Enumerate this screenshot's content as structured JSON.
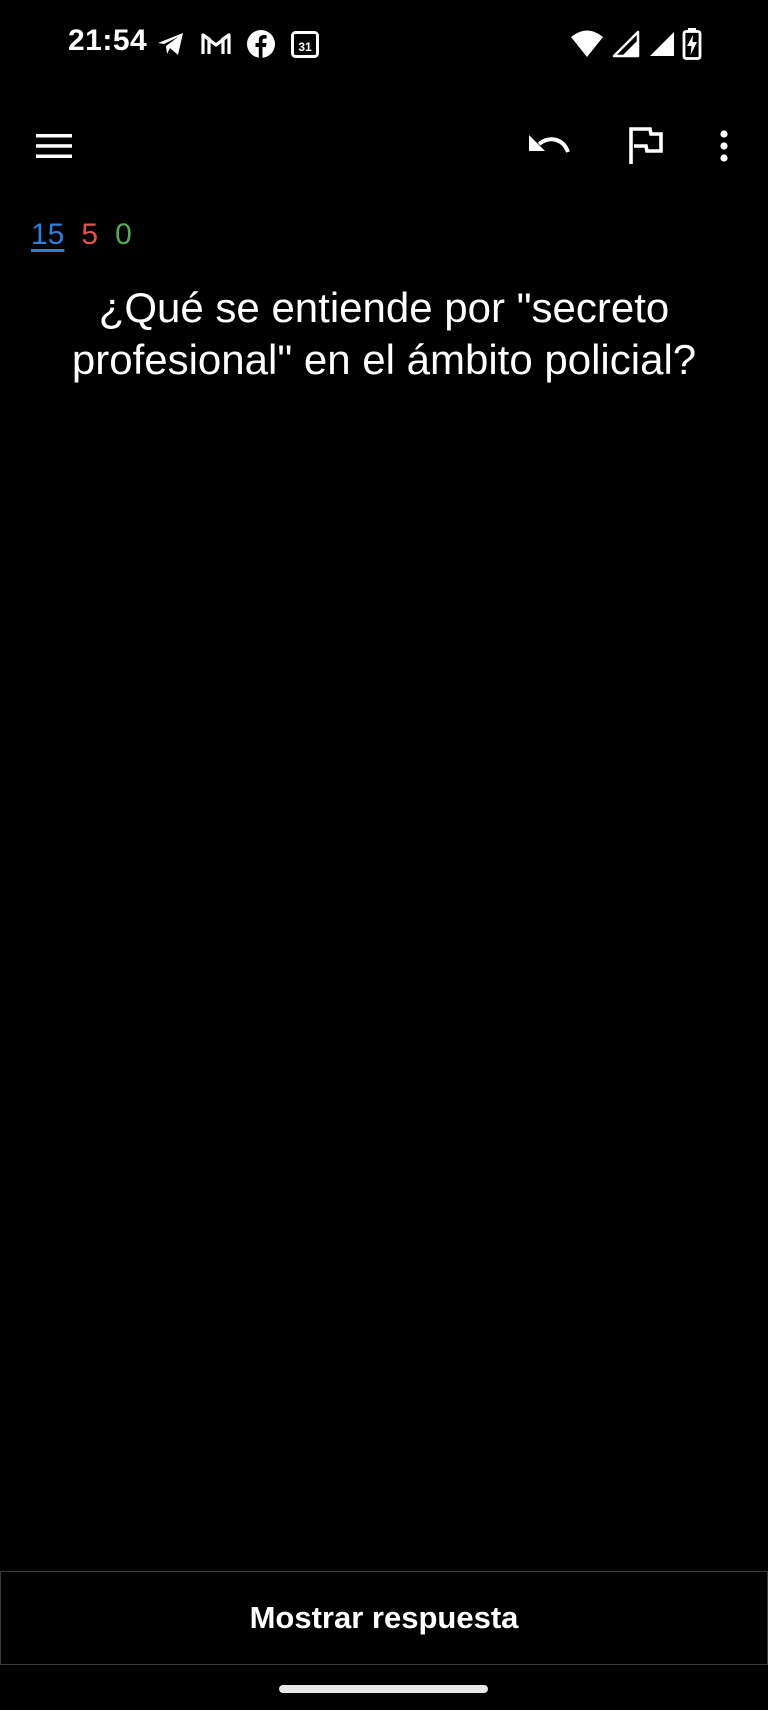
{
  "status_bar": {
    "time": "21:54",
    "calendar_day": "31",
    "notification_icons": [
      "telegram-icon",
      "gmail-icon",
      "facebook-icon",
      "calendar-icon"
    ],
    "system_icons": [
      "wifi-icon",
      "cell-signal-icon",
      "cell-signal-icon",
      "battery-charging-icon"
    ]
  },
  "toolbar": {
    "icons": [
      "menu-icon",
      "undo-icon",
      "flag-icon",
      "more-vert-icon"
    ]
  },
  "counts": {
    "new": "15",
    "learning": "5",
    "review": "0",
    "colors": {
      "new": "#2f7fd6",
      "learning": "#e0544a",
      "review": "#53a853"
    }
  },
  "card": {
    "question": "¿Qué se entiende por \"secreto profesional\" en el ámbito policial?"
  },
  "footer": {
    "show_answer_label": "Mostrar respuesta"
  }
}
